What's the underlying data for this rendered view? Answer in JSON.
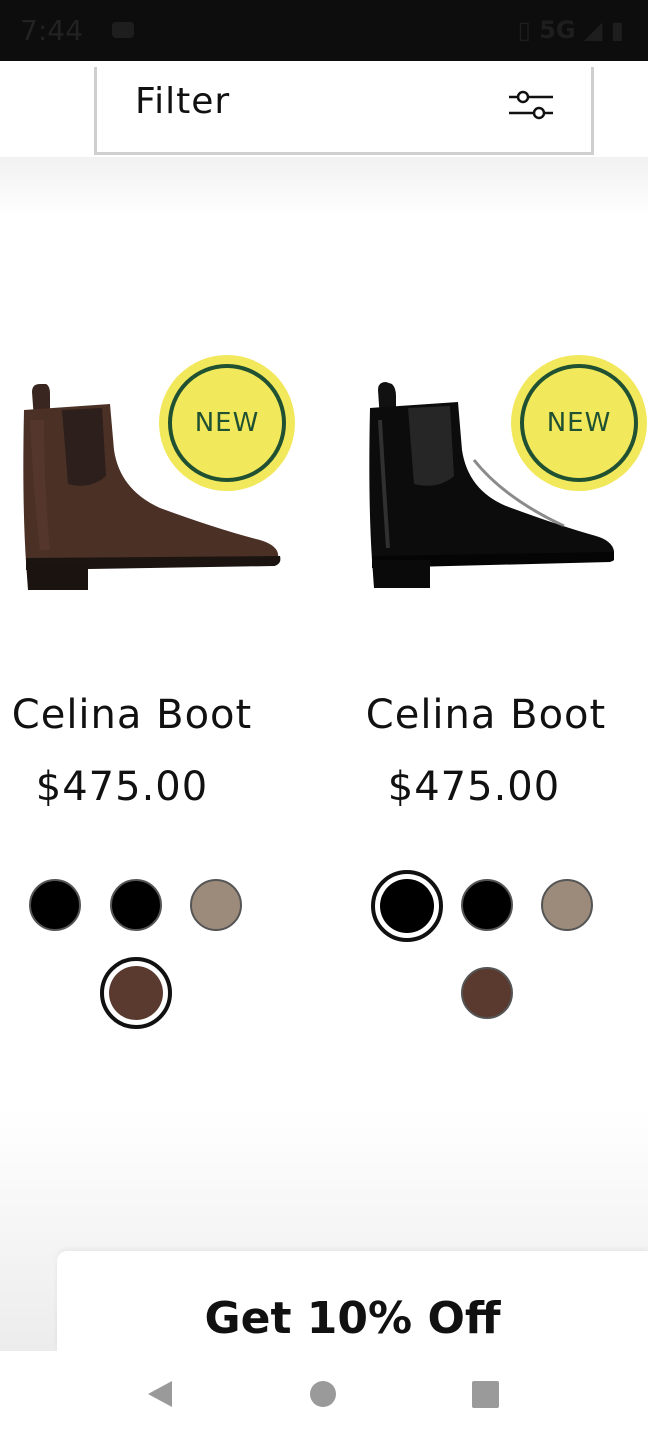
{
  "status_bar": {
    "time": "7:44",
    "network": "5G"
  },
  "filter": {
    "label": "Filter"
  },
  "products": [
    {
      "badge": "NEW",
      "name": "Celina Boot",
      "price": "$475.00",
      "color": "brown suede",
      "swatches": [
        "#000000",
        "#000000",
        "#9c8b7b",
        "#5a3a2f"
      ],
      "selected_swatch": 3
    },
    {
      "badge": "NEW",
      "name": "Celina Boot",
      "price": "$475.00",
      "color": "black patent",
      "swatches": [
        "#000000",
        "#000000",
        "#9c8b7b",
        "#5a3a2f"
      ],
      "selected_swatch": 0
    }
  ],
  "promo": {
    "text": "Get 10% Off"
  },
  "colors": {
    "badge_fill": "#f2e85c",
    "badge_ring": "#1f5132"
  }
}
